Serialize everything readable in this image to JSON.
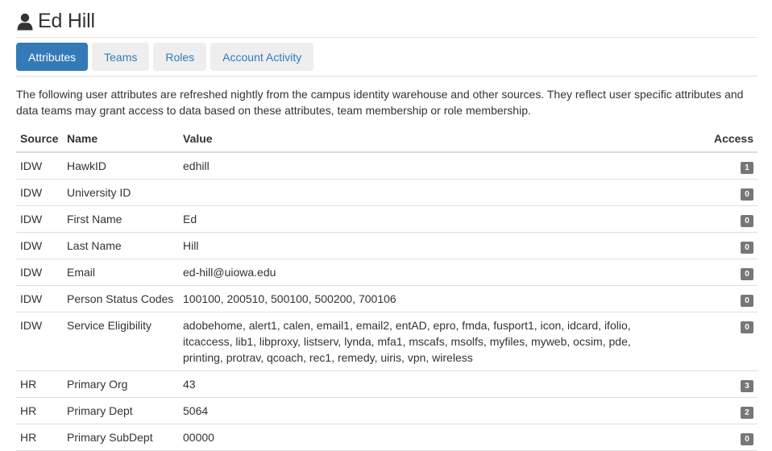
{
  "header": {
    "title": "Ed Hill",
    "icon": "user-icon"
  },
  "tabs": [
    {
      "label": "Attributes",
      "active": true
    },
    {
      "label": "Teams",
      "active": false
    },
    {
      "label": "Roles",
      "active": false
    },
    {
      "label": "Account Activity",
      "active": false
    }
  ],
  "intro": "The following user attributes are refreshed nightly from the campus identity warehouse and other sources. They reflect user specific attributes and data teams may grant access to data based on these attributes, team membership or role membership.",
  "table": {
    "headers": {
      "source": "Source",
      "name": "Name",
      "value": "Value",
      "access": "Access"
    },
    "rows": [
      {
        "source": "IDW",
        "name": "HawkID",
        "value": "edhill",
        "access": "1"
      },
      {
        "source": "IDW",
        "name": "University ID",
        "value": "",
        "access": "0"
      },
      {
        "source": "IDW",
        "name": "First Name",
        "value": "Ed",
        "access": "0"
      },
      {
        "source": "IDW",
        "name": "Last Name",
        "value": "Hill",
        "access": "0"
      },
      {
        "source": "IDW",
        "name": "Email",
        "value": "ed-hill@uiowa.edu",
        "access": "0"
      },
      {
        "source": "IDW",
        "name": "Person Status Codes",
        "value": "100100, 200510, 500100, 500200, 700106",
        "access": "0"
      },
      {
        "source": "IDW",
        "name": "Service Eligibility",
        "value": "adobehome, alert1, calen, email1, email2, entAD, epro, fmda, fusport1, icon, idcard, ifolio, itcaccess, lib1, libproxy, listserv, lynda, mfa1, mscafs, msolfs, myfiles, myweb, ocsim, pde, printing, protrav, qcoach, rec1, remedy, uiris, vpn, wireless",
        "access": "0"
      },
      {
        "source": "HR",
        "name": "Primary Org",
        "value": "43",
        "access": "3"
      },
      {
        "source": "HR",
        "name": "Primary Dept",
        "value": "5064",
        "access": "2"
      },
      {
        "source": "HR",
        "name": "Primary SubDept",
        "value": "00000",
        "access": "0"
      }
    ]
  },
  "colors": {
    "primary": "#337ab7",
    "tab_bg": "#eeeeee",
    "badge_bg": "#777777",
    "border": "#dddddd"
  }
}
